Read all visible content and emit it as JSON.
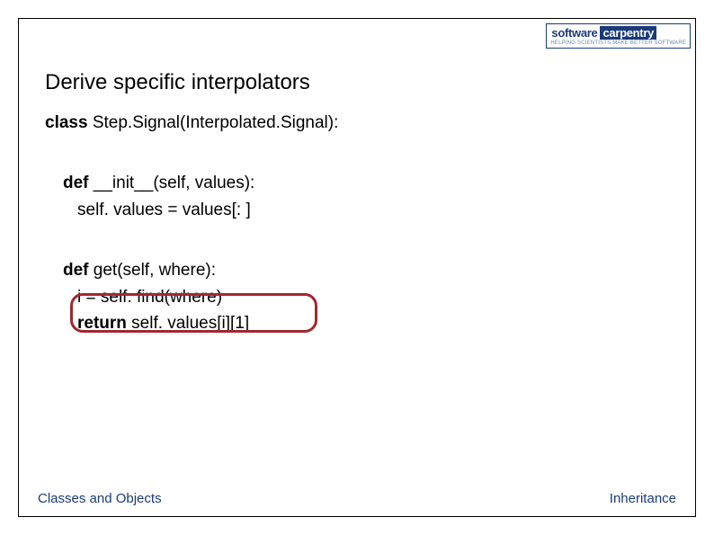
{
  "logo": {
    "software": "software",
    "carpentry": "carpentry",
    "subtitle": "HELPING SCIENTISTS MAKE BETTER SOFTWARE"
  },
  "title": "Derive specific interpolators",
  "code": {
    "class_kw": "class",
    "class_decl": " Step.Signal(Interpolated.Signal):",
    "def_kw": "def",
    "init_sig": " __init__(self, values):",
    "init_body": "self. values = values[: ]",
    "get_sig": " get(self, where):",
    "get_body1": "i = self. find(where)",
    "return_kw": "return",
    "get_body2": " self. values[i][1]"
  },
  "footer": {
    "left": "Classes and Objects",
    "right": "Inheritance"
  }
}
